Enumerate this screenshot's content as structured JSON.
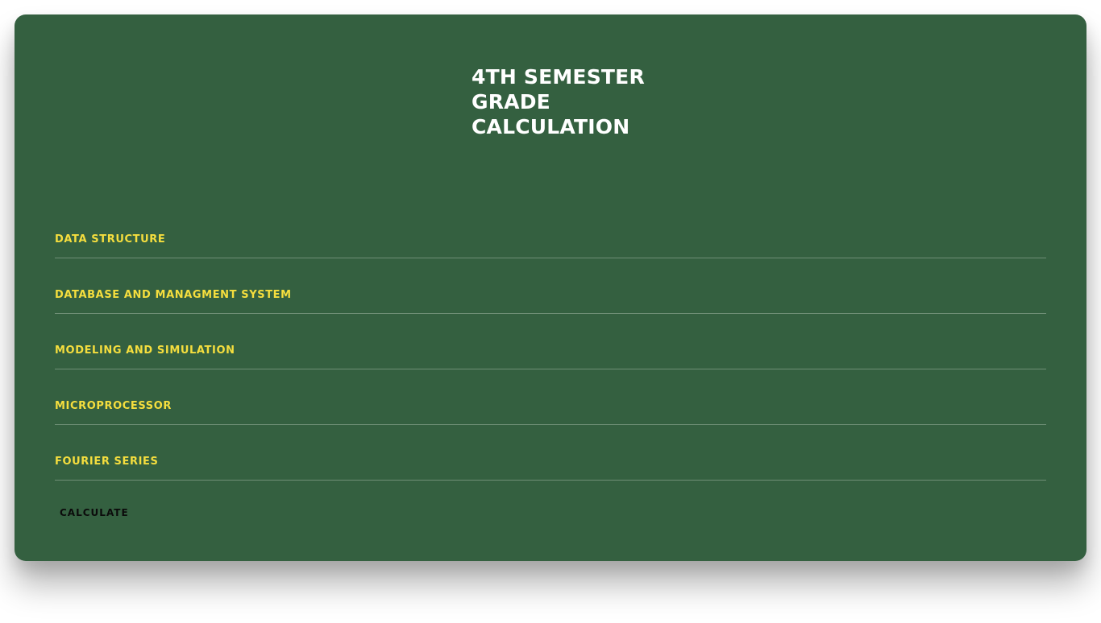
{
  "title": {
    "line1": "4TH SEMESTER",
    "line2": "GRADE",
    "line3": "CALCULATION"
  },
  "fields": [
    {
      "label": "DATA STRUCTURE",
      "value": ""
    },
    {
      "label": "DATABASE AND MANAGMENT SYSTEM",
      "value": ""
    },
    {
      "label": "MODELING AND SIMULATION",
      "value": ""
    },
    {
      "label": "MICROPROCESSOR",
      "value": ""
    },
    {
      "label": "FOURIER SERIES",
      "value": ""
    }
  ],
  "button": {
    "label": "CALCULATE"
  },
  "colors": {
    "card_background": "#346040",
    "title_text": "#ffffff",
    "label_text": "#f5de3e",
    "button_text": "#0b0b0b"
  }
}
